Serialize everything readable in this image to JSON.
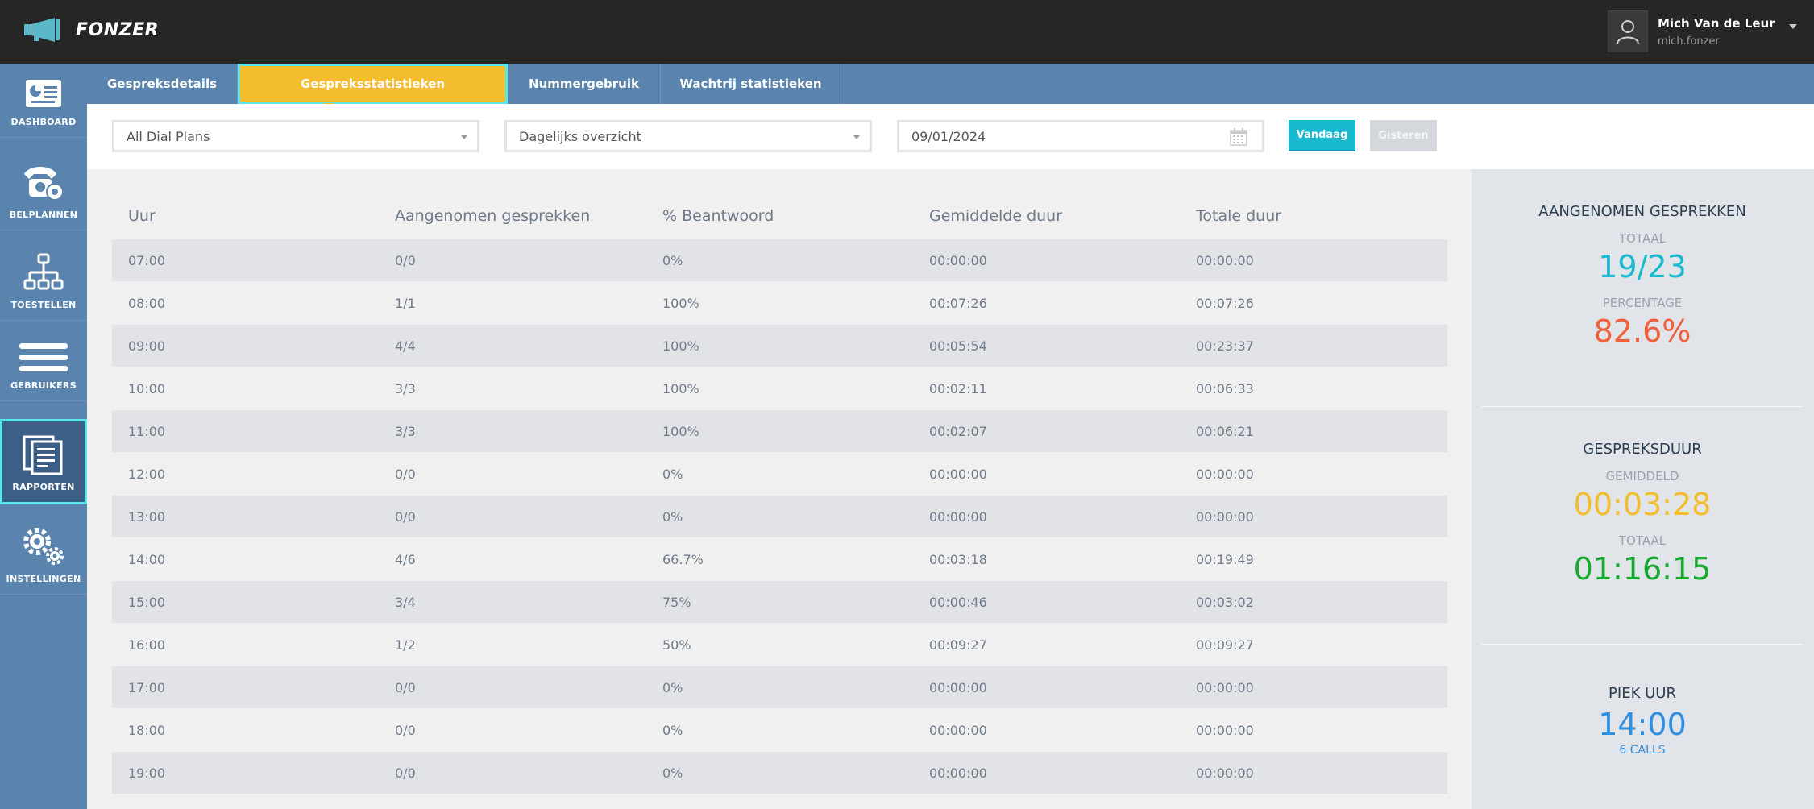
{
  "app": {
    "name": "FONZER"
  },
  "user": {
    "name": "Mich Van de Leur",
    "login": "mich.fonzer"
  },
  "sidebar": {
    "items": [
      {
        "label": "DASHBOARD"
      },
      {
        "label": "BELPLANNEN"
      },
      {
        "label": "TOESTELLEN"
      },
      {
        "label": "GEBRUIKERS"
      },
      {
        "label": "RAPPORTEN",
        "active": true
      },
      {
        "label": "INSTELLINGEN"
      }
    ]
  },
  "tabs": [
    {
      "label": "Gespreksdetails"
    },
    {
      "label": "Gespreksstatistieken",
      "active": true
    },
    {
      "label": "Nummergebruik"
    },
    {
      "label": "Wachtrij statistieken"
    }
  ],
  "filters": {
    "dial_plan": "All Dial Plans",
    "overview": "Dagelijks overzicht",
    "date": "09/01/2024",
    "today_button": "Vandaag",
    "yesterday_button": "Gisteren"
  },
  "table": {
    "headers": [
      "Uur",
      "Aangenomen gesprekken",
      "% Beantwoord",
      "Gemiddelde duur",
      "Totale duur"
    ],
    "rows": [
      [
        "07:00",
        "0/0",
        "0%",
        "00:00:00",
        "00:00:00"
      ],
      [
        "08:00",
        "1/1",
        "100%",
        "00:07:26",
        "00:07:26"
      ],
      [
        "09:00",
        "4/4",
        "100%",
        "00:05:54",
        "00:23:37"
      ],
      [
        "10:00",
        "3/3",
        "100%",
        "00:02:11",
        "00:06:33"
      ],
      [
        "11:00",
        "3/3",
        "100%",
        "00:02:07",
        "00:06:21"
      ],
      [
        "12:00",
        "0/0",
        "0%",
        "00:00:00",
        "00:00:00"
      ],
      [
        "13:00",
        "0/0",
        "0%",
        "00:00:00",
        "00:00:00"
      ],
      [
        "14:00",
        "4/6",
        "66.7%",
        "00:03:18",
        "00:19:49"
      ],
      [
        "15:00",
        "3/4",
        "75%",
        "00:00:46",
        "00:03:02"
      ],
      [
        "16:00",
        "1/2",
        "50%",
        "00:09:27",
        "00:09:27"
      ],
      [
        "17:00",
        "0/0",
        "0%",
        "00:00:00",
        "00:00:00"
      ],
      [
        "18:00",
        "0/0",
        "0%",
        "00:00:00",
        "00:00:00"
      ],
      [
        "19:00",
        "0/0",
        "0%",
        "00:00:00",
        "00:00:00"
      ]
    ]
  },
  "stats": {
    "answered": {
      "title": "AANGENOMEN GESPREKKEN",
      "total_label": "TOTAAL",
      "total": "19/23",
      "pct_label": "PERCENTAGE",
      "pct": "82.6%"
    },
    "duration": {
      "title": "GESPREKSDUUR",
      "avg_label": "GEMIDDELD",
      "avg": "00:03:28",
      "total_label": "TOTAAL",
      "total": "01:16:15"
    },
    "peak": {
      "title": "PIEK UUR",
      "hour": "14:00",
      "calls": "6 CALLS"
    }
  },
  "colors": {
    "accent_cyan": "#19b9cf",
    "tab_active": "#f3bd2e",
    "sidebar": "#5a84ad",
    "stat_red": "#f0603a",
    "stat_orange": "#f3bd2e",
    "stat_green": "#17a82f",
    "stat_blue": "#2f8fe0"
  }
}
